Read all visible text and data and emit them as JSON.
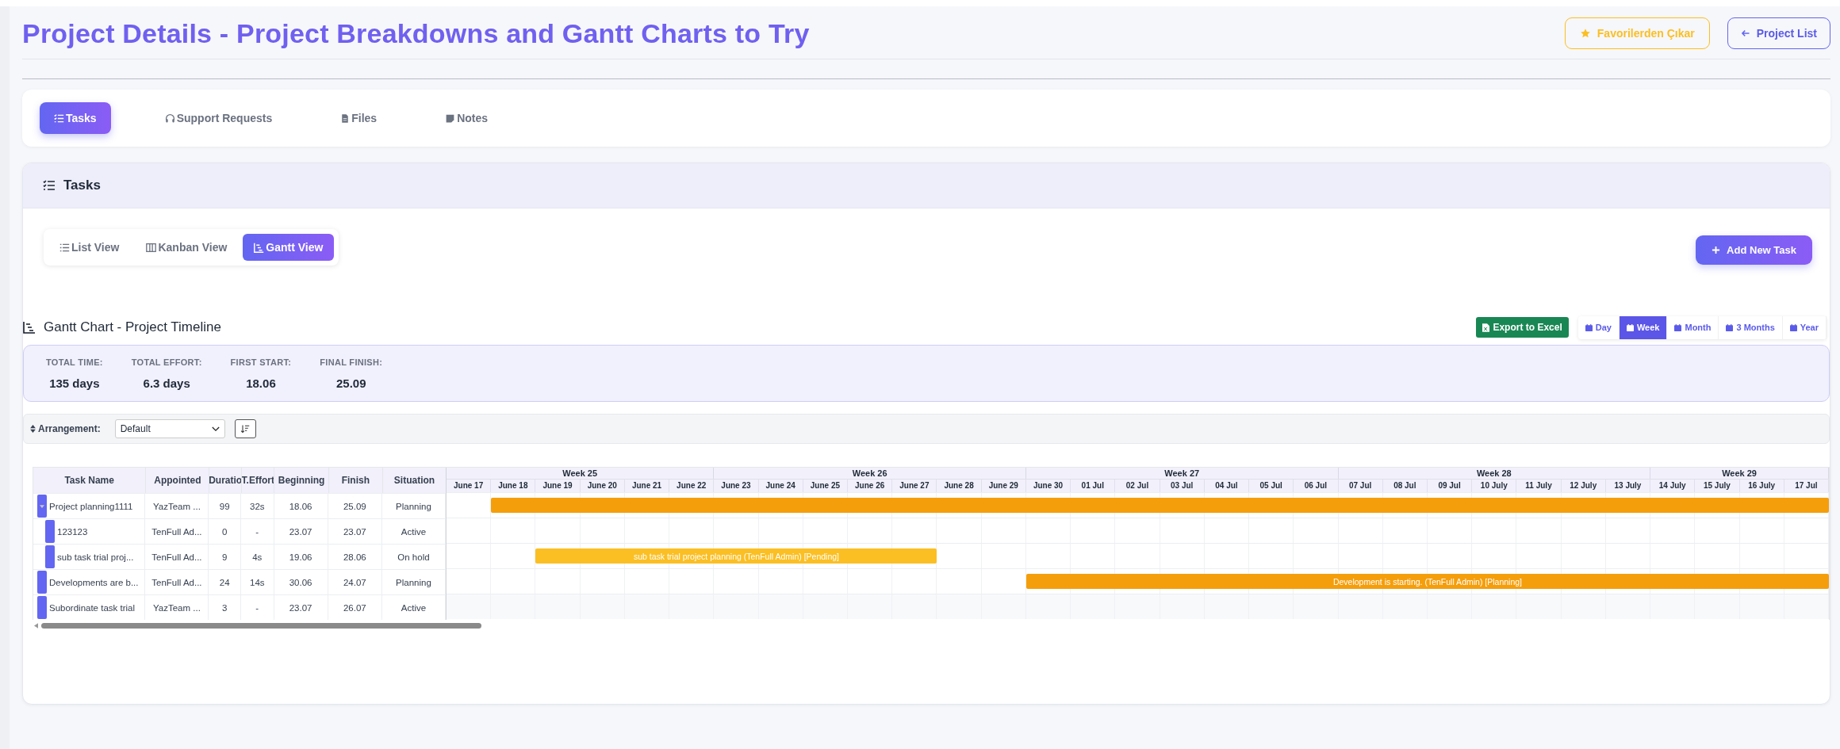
{
  "header": {
    "title": "Project Details - Project Breakdowns and Gantt Charts to Try",
    "favorite_button": "Favorilerden Çıkar",
    "back_button": "Project List"
  },
  "tabs": [
    {
      "label": "Tasks",
      "kind": "tasks",
      "selected": true
    },
    {
      "label": "Support Requests",
      "kind": "support",
      "selected": false
    },
    {
      "label": "Files",
      "kind": "files",
      "selected": false
    },
    {
      "label": "Notes",
      "kind": "notes",
      "selected": false
    }
  ],
  "tasks_panel": {
    "title": "Tasks",
    "views": [
      {
        "label": "List View",
        "kind": "list",
        "selected": false
      },
      {
        "label": "Kanban View",
        "kind": "kanban",
        "selected": false
      },
      {
        "label": "Gantt View",
        "kind": "gantt",
        "selected": true
      }
    ],
    "add_button": "Add New Task"
  },
  "gantt": {
    "title": "Gantt Chart - Project Timeline",
    "export_button": "Export to Excel",
    "scales": [
      {
        "label": "Day",
        "selected": false
      },
      {
        "label": "Week",
        "selected": true
      },
      {
        "label": "Month",
        "selected": false
      },
      {
        "label": "3 Months",
        "selected": false
      },
      {
        "label": "Year",
        "selected": false
      }
    ],
    "stats": [
      {
        "label": "TOTAL TIME:",
        "value": "135 days"
      },
      {
        "label": "TOTAL EFFORT:",
        "value": "6.3 days"
      },
      {
        "label": "FIRST START:",
        "value": "18.06"
      },
      {
        "label": "FINAL FINISH:",
        "value": "25.09"
      }
    ],
    "arrangement": {
      "label": "Arrangement:",
      "value": "Default"
    },
    "columns": [
      "Task Name",
      "Appointed",
      "Duratio",
      "T.Effort",
      "Beginning",
      "Finish",
      "Situation"
    ],
    "weeks": [
      {
        "label": "Week 25",
        "days": [
          "June 17",
          "June 18",
          "June 19",
          "June 20",
          "June 21",
          "June 22"
        ]
      },
      {
        "label": "Week 26",
        "days": [
          "June 23",
          "June 24",
          "June 25",
          "June 26",
          "June 27",
          "June 28",
          "June 29"
        ]
      },
      {
        "label": "Week 27",
        "days": [
          "June 30",
          "01 Jul",
          "02 Jul",
          "03 Jul",
          "04 Jul",
          "05 Jul",
          "06 Jul"
        ]
      },
      {
        "label": "Week 28",
        "days": [
          "07 Jul",
          "08 Jul",
          "09 Jul",
          "10 July",
          "11 July",
          "12 July",
          "13 July"
        ]
      },
      {
        "label": "Week 29",
        "days": [
          "14 July",
          "15 July",
          "16 July",
          "17 Jul"
        ]
      }
    ],
    "tasks": [
      {
        "name": "Project planning1111",
        "appointed": "YazTeam ...",
        "duration": "99",
        "effort": "32s",
        "beginning": "18.06",
        "finish": "25.09",
        "situation": "Planning",
        "expanded": true,
        "bar": {
          "color": "#f59e0b"
        },
        "children": [
          {
            "name": "123123",
            "appointed": "TenFull Ad...",
            "duration": "0",
            "effort": "-",
            "beginning": "23.07",
            "finish": "23.07",
            "situation": "Active"
          },
          {
            "name": "sub task trial proj...",
            "appointed": "TenFull Ad...",
            "duration": "9",
            "effort": "4s",
            "beginning": "19.06",
            "finish": "28.06",
            "situation": "On hold",
            "bar": {
              "color": "#fbbf24",
              "label": "sub task trial project planning (TenFull Admin) [Pending]"
            }
          }
        ]
      },
      {
        "name": "Developments are b...",
        "appointed": "TenFull Ad...",
        "duration": "24",
        "effort": "14s",
        "beginning": "30.06",
        "finish": "24.07",
        "situation": "Planning",
        "bar": {
          "color": "#f59e0b",
          "label": "Development is starting. (TenFull Admin) [Planning]"
        }
      },
      {
        "name": "Subordinate task trial",
        "appointed": "YazTeam ...",
        "duration": "3",
        "effort": "-",
        "beginning": "23.07",
        "finish": "26.07",
        "situation": "Active"
      }
    ]
  }
}
